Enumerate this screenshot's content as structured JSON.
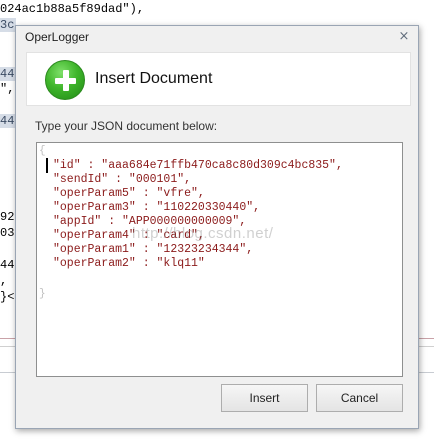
{
  "background": {
    "top_line": "024ac1b88a5f89dad\"),",
    "fragments": [
      "3c",
      "44",
      "\",",
      "44",
      "92",
      "03",
      "44",
      ",",
      "}<"
    ]
  },
  "dialog": {
    "title": "OperLogger",
    "close_icon": "close-icon",
    "header": {
      "icon": "plus-icon",
      "title": "Insert Document"
    },
    "prompt": "Type your JSON document below:",
    "editor": {
      "open_brace": "{",
      "close_brace": "}",
      "lines": [
        "\"id\" : \"aaa684e71ffb470ca8c80d309c4bc835\",",
        "\"sendId\" : \"000101\",",
        "\"operParam5\" : \"vfre\",",
        "\"operParam3\" : \"110220330440\",",
        "\"appId\" : \"APP000000000009\",",
        "\"operParam4\" : \"card\",",
        "\"operParam1\" : \"12323234344\",",
        "\"operParam2\" : \"klq11\""
      ],
      "watermark": "http://blog.csdn.net/"
    },
    "buttons": {
      "insert": "Insert",
      "cancel": "Cancel"
    }
  }
}
